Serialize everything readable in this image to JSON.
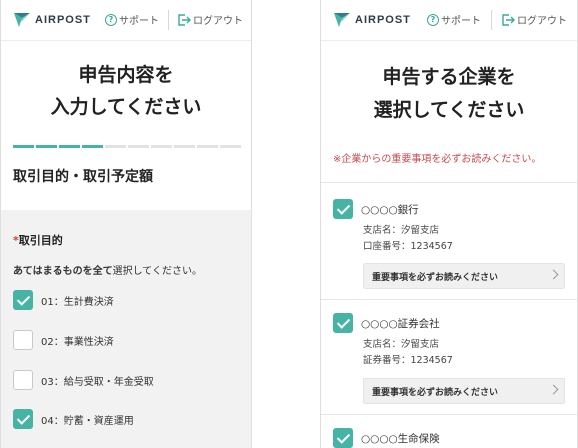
{
  "header": {
    "logo_text": "AIRPOST",
    "support_label": "サポート",
    "logout_label": "ログアウト"
  },
  "left": {
    "title_line1": "申告内容を",
    "title_line2": "入力してください",
    "progress": {
      "total": 10,
      "completed": 4
    },
    "section_title": "取引目的・取引予定額",
    "required_mark": "*",
    "field_label": "取引目的",
    "instruction_bold": "あてはまるものを全て",
    "instruction_rest": "選択してください。",
    "options": [
      {
        "label": "01：生計費決済",
        "checked": true
      },
      {
        "label": "02：事業性決済",
        "checked": false
      },
      {
        "label": "03：給与受取・年金受取",
        "checked": false
      },
      {
        "label": "04：貯蓄・資産運用",
        "checked": true
      }
    ]
  },
  "right": {
    "title_line1": "申告する企業を",
    "title_line2": "選択してください",
    "notice": "※企業からの重要事項を必ずお読みください。",
    "companies": [
      {
        "name": "○○○○銀行",
        "branch": "支店名：汐留支店",
        "account": "口座番号：1234567",
        "button": "重要事項を必ずお読みください",
        "checked": true
      },
      {
        "name": "○○○○証券会社",
        "branch": "支店名：汐留支店",
        "account": "証券番号：1234567",
        "button": "重要事項を必ずお読みください",
        "checked": true
      },
      {
        "name": "○○○○生命保険",
        "checked": true
      }
    ]
  },
  "colors": {
    "accent": "#46b3a4",
    "notice": "#c94b4b"
  }
}
